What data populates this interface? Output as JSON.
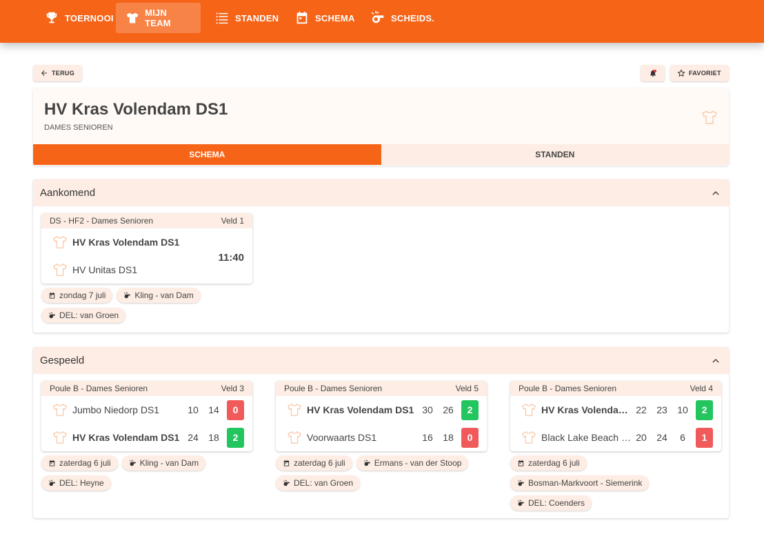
{
  "nav": {
    "items": [
      {
        "label": "TOERNOOI",
        "icon": "trophy-icon"
      },
      {
        "label": "MIJN TEAM",
        "icon": "shirt-icon",
        "active": true
      },
      {
        "label": "STANDEN",
        "icon": "list-icon"
      },
      {
        "label": "SCHEMA",
        "icon": "calendar-icon"
      },
      {
        "label": "SCHEIDS.",
        "icon": "whistle-icon"
      }
    ]
  },
  "actions": {
    "back_label": "TERUG",
    "favorite_label": "FAVORIET",
    "bell_icon": "bell-icon"
  },
  "team": {
    "name": "HV Kras Volendam DS1",
    "category": "DAMES SENIOREN"
  },
  "tabs": [
    {
      "label": "SCHEMA",
      "active": true
    },
    {
      "label": "STANDEN",
      "active": false
    }
  ],
  "upcoming": {
    "title": "Aankomend",
    "match": {
      "poule": "DS - HF2 - Dames Senioren",
      "field": "Veld 1",
      "home": "HV Kras Volendam DS1",
      "away": "HV Unitas DS1",
      "time": "11:40",
      "date": "zondag 7 juli",
      "referees": "Kling - van Dam",
      "del": "DEL: van Groen"
    }
  },
  "played": {
    "title": "Gespeeld",
    "matches": [
      {
        "poule": "Poule B - Dames Senioren",
        "field": "Veld 3",
        "home": {
          "name": "Jumbo Niedorp DS1",
          "bold": false,
          "s1": "10",
          "s2": "14",
          "s3": "",
          "result": "0",
          "win": false
        },
        "away": {
          "name": "HV Kras Volendam DS1",
          "bold": true,
          "s1": "24",
          "s2": "18",
          "s3": "",
          "result": "2",
          "win": true
        },
        "date": "zaterdag 6 juli",
        "referees": "Kling - van Dam",
        "del": "DEL: Heyne"
      },
      {
        "poule": "Poule B - Dames Senioren",
        "field": "Veld 5",
        "home": {
          "name": "HV Kras Volendam DS1",
          "bold": true,
          "s1": "30",
          "s2": "26",
          "s3": "",
          "result": "2",
          "win": true
        },
        "away": {
          "name": "Voorwaarts DS1",
          "bold": false,
          "s1": "16",
          "s2": "18",
          "s3": "",
          "result": "0",
          "win": false
        },
        "date": "zaterdag 6 juli",
        "referees": "Ermans - van der Stoop",
        "del": "DEL: van Groen"
      },
      {
        "poule": "Poule B - Dames Senioren",
        "field": "Veld 4",
        "home": {
          "name": "HV Kras Volendam…",
          "bold": true,
          "s1": "22",
          "s2": "23",
          "s3": "10",
          "result": "2",
          "win": true
        },
        "away": {
          "name": "Black Lake Beach …",
          "bold": false,
          "s1": "20",
          "s2": "24",
          "s3": "6",
          "result": "1",
          "win": false
        },
        "date": "zaterdag 6 juli",
        "referees": "Bosman-Markvoort - Siemerink",
        "del": "DEL: Coenders"
      }
    ]
  },
  "colors": {
    "primary": "#f66418",
    "tint": "#fdede4",
    "win": "#22c55e",
    "loss": "#f05a5a"
  }
}
